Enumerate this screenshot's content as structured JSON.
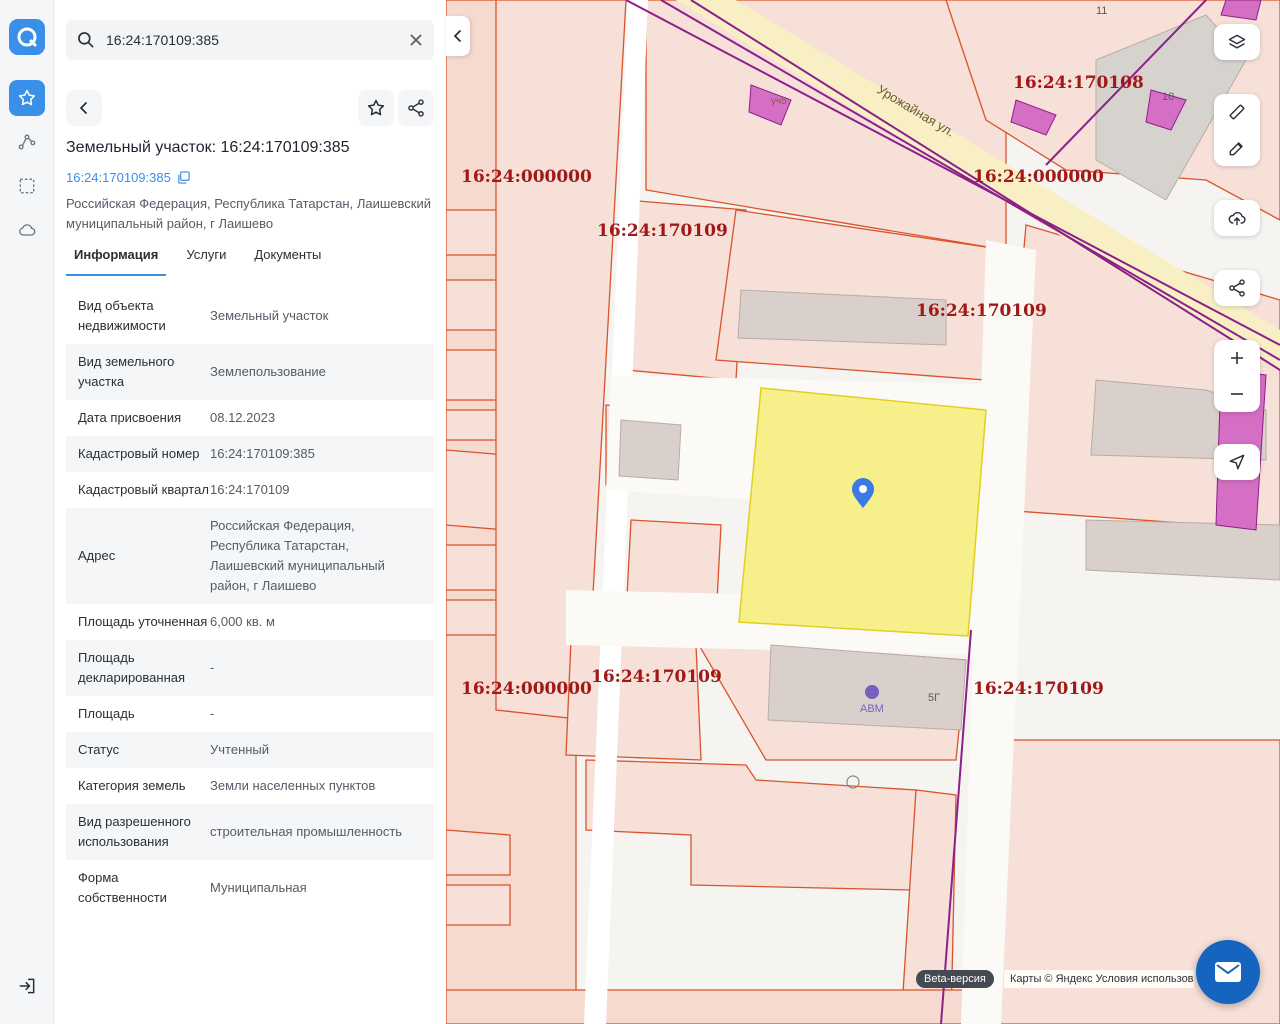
{
  "search": {
    "value": "16:24:170109:385"
  },
  "object": {
    "title": "Земельный участок: 16:24:170109:385",
    "cadastral_link": "16:24:170109:385",
    "address": "Российская Федерация, Республика Татарстан, Лаишевский муниципальный район, г Лаишево"
  },
  "tabs": [
    {
      "label": "Информация"
    },
    {
      "label": "Услуги"
    },
    {
      "label": "Документы"
    }
  ],
  "info": [
    {
      "key": "Вид объекта недвижимости",
      "value": "Земельный участок"
    },
    {
      "key": "Вид земельного участка",
      "value": "Землепользование"
    },
    {
      "key": "Дата присвоения",
      "value": "08.12.2023"
    },
    {
      "key": "Кадастровый номер",
      "value": "16:24:170109:385"
    },
    {
      "key": "Кадастровый квартал",
      "value": "16:24:170109"
    },
    {
      "key": "Адрес",
      "value": "Российская Федерация, Республика Татарстан, Лаишевский муниципальный район, г Лаишево"
    },
    {
      "key": "Площадь уточненная",
      "value": "6,000 кв. м"
    },
    {
      "key": "Площадь декларированная",
      "value": "-"
    },
    {
      "key": "Площадь",
      "value": "-"
    },
    {
      "key": "Статус",
      "value": "Учтенный"
    },
    {
      "key": "Категория земель",
      "value": "Земли населенных пунктов"
    },
    {
      "key": "Вид разрешенного использования",
      "value": "строительная промышленность"
    },
    {
      "key": "Форма собственности",
      "value": "Муниципальная"
    }
  ],
  "map": {
    "quarter_labels": [
      "16:24:000000",
      "16:24:170109",
      "16:24:170108",
      "16:24:000000",
      "16:24:170109",
      "16:24:000000",
      "16:24:170109",
      "16:24:170109"
    ],
    "street": "Урожайная ул.",
    "house_numbers": [
      "11",
      "10",
      "уч5",
      "5Г"
    ],
    "poi_label": "АВМ",
    "beta_badge": "Beta-версия",
    "copyright": "Карты © Яндекс  Условия использования"
  },
  "icons": [
    "logo-icon",
    "star-icon",
    "route-icon",
    "select-area-icon",
    "cloud-icon",
    "logout-icon",
    "search-icon",
    "close-icon",
    "back-icon",
    "share-icon",
    "copy-icon",
    "layers-icon",
    "ruler-icon",
    "edit-icon",
    "upload-icon",
    "zoom-in-icon",
    "zoom-out-icon",
    "locate-icon",
    "mail-icon",
    "location-pin-icon"
  ],
  "colors": {
    "accent": "#3a8fe8",
    "parcel_outline": "#d9532c",
    "selected_parcel": "#f7f08a",
    "cad_label": "#a01818",
    "power_line": "#8c1f8c"
  }
}
